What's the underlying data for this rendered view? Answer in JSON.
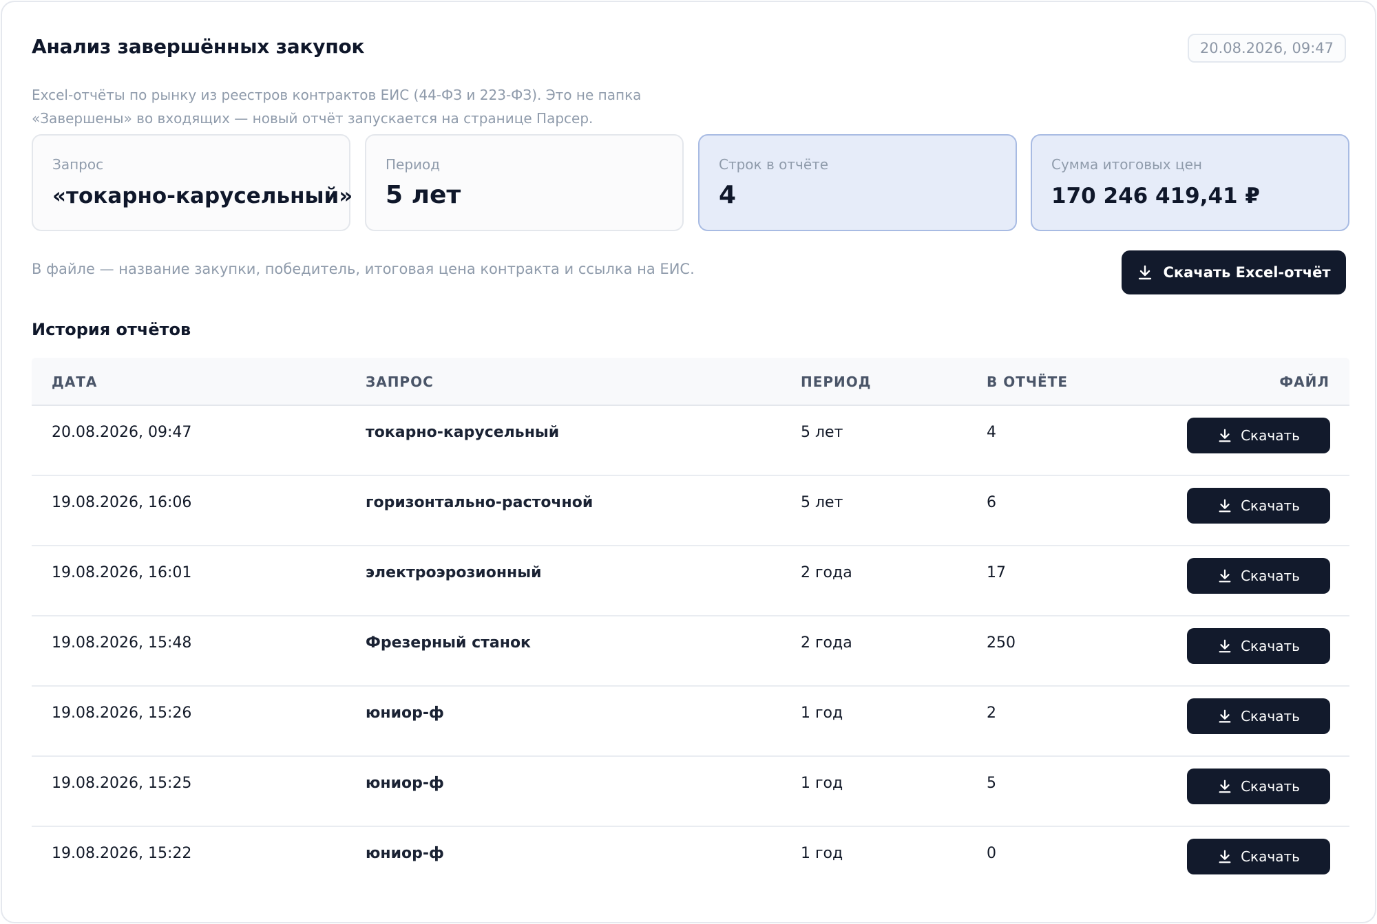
{
  "header": {
    "title": "Анализ завершённых закупок",
    "timestamp": "20.08.2026, 09:47"
  },
  "description": "Excel-отчёты по рынку из реестров контрактов ЕИС (44-ФЗ и 223-ФЗ). Это не папка «Завершены» во входящих — новый отчёт запускается на странице Парсер.",
  "stats": [
    {
      "label": "Запрос",
      "value": "«токарно-карусельный»"
    },
    {
      "label": "Период",
      "value": "5 лет"
    },
    {
      "label": "Строк в отчёте",
      "value": "4"
    },
    {
      "label": "Сумма итоговых цен",
      "value": "170 246 419,41 ₽"
    }
  ],
  "file_note": "В файле — название закупки, победитель, итоговая цена контракта и ссылка на ЕИС.",
  "download_button": {
    "label": "Скачать Excel-отчёт",
    "icon": "download-icon"
  },
  "history": {
    "title": "История отчётов",
    "columns": [
      "ДАТА",
      "ЗАПРОС",
      "ПЕРИОД",
      "В ОТЧЁТЕ",
      "ФАЙЛ"
    ],
    "rows": [
      {
        "date": "20.08.2026, 09:47",
        "query": "токарно-карусельный",
        "period": "5 лет",
        "count": "4",
        "action": "Скачать"
      },
      {
        "date": "19.08.2026, 16:06",
        "query": "горизонтально-расточной",
        "period": "5 лет",
        "count": "6",
        "action": "Скачать"
      },
      {
        "date": "19.08.2026, 16:01",
        "query": "электроэрозионный",
        "period": "2 года",
        "count": "17",
        "action": "Скачать"
      },
      {
        "date": "19.08.2026, 15:48",
        "query": "Фрезерный станок",
        "period": "2 года",
        "count": "250",
        "action": "Скачать"
      },
      {
        "date": "19.08.2026, 15:26",
        "query": "юниор-ф",
        "period": "1 год",
        "count": "2",
        "action": "Скачать"
      },
      {
        "date": "19.08.2026, 15:25",
        "query": "юниор-ф",
        "period": "1 год",
        "count": "5",
        "action": "Скачать"
      },
      {
        "date": "19.08.2026, 15:22",
        "query": "юниор-ф",
        "period": "1 год",
        "count": "0",
        "action": "Скачать"
      }
    ]
  },
  "colors": {
    "button_bg": "#121a2c",
    "highlight_card_bg": "#e6ecf9",
    "highlight_card_border": "#a8bbe3",
    "muted_text": "#8f9bab"
  }
}
